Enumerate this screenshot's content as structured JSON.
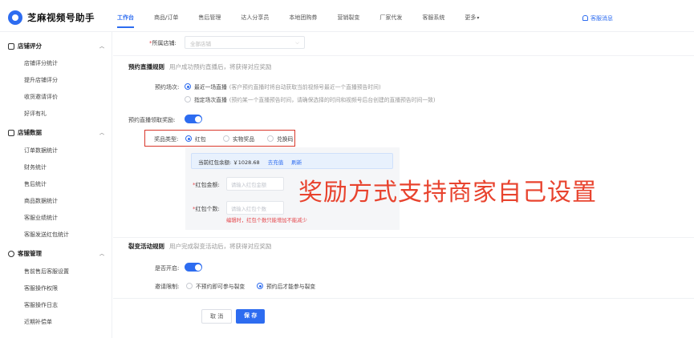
{
  "app": {
    "title": "芝麻视频号助手"
  },
  "nav": {
    "items": [
      "工作台",
      "商品/订单",
      "售后管理",
      "达人分享员",
      "本地团购券",
      "营销裂变",
      "厂家代发",
      "客服系统",
      "更多"
    ],
    "active_index": 0,
    "message": "客服消息"
  },
  "sidebar": {
    "groups": [
      {
        "title": "店铺评分",
        "icon": "shop-icon",
        "items": [
          "店铺评分统计",
          "提升店铺评分",
          "收货邀请评价",
          "好评有礼"
        ]
      },
      {
        "title": "店铺数据",
        "icon": "chart-icon",
        "items": [
          "订单数据统计",
          "财务统计",
          "售后统计",
          "商品数据统计",
          "客服业绩统计",
          "客服发送红包统计"
        ]
      },
      {
        "title": "客服管理",
        "icon": "headset-icon",
        "items": [
          "售前售后客服设置",
          "客服操作权限",
          "客服操作日志",
          "近期补偿单"
        ]
      }
    ]
  },
  "form": {
    "store": {
      "label": "所属店铺:",
      "placeholder": "全部店铺"
    },
    "live_section": {
      "title": "预约直播规则",
      "hint": "用户成功预约直播后，将获得对应奖励"
    },
    "live_session": {
      "label": "预约场次:",
      "options": [
        {
          "label": "最近一场直播",
          "note": "(客户预约直播时将自动获取当前视频号最近一个直播预告时间)",
          "selected": true
        },
        {
          "label": "指定场次直播",
          "note": "(预约某一个直播预告时间，请确保选择的时间和视频号后台创建的直播预告时间一致)",
          "selected": false
        }
      ]
    },
    "reward_toggle": {
      "label": "预约直播领取奖励:",
      "on": true
    },
    "reward_type": {
      "label": "奖品类型:",
      "options": [
        {
          "label": "红包",
          "selected": true
        },
        {
          "label": "实物奖品",
          "selected": false
        },
        {
          "label": "兑换码",
          "selected": false
        }
      ]
    },
    "balance": {
      "text": "当前红包余额: ￥1028.68",
      "recharge": "去充值",
      "refresh": "刷新"
    },
    "amount": {
      "label": "红包金额:",
      "placeholder": "请输入红包金额"
    },
    "count": {
      "label": "红包个数:",
      "placeholder": "请输入红包个数",
      "warning": "编辑时，红包个数只能增加不能减少"
    },
    "fission_section": {
      "title": "裂变活动规则",
      "hint": "用户完成裂变活动后，将获得对应奖励"
    },
    "fission_toggle": {
      "label": "是否开启:",
      "on": true
    },
    "invite_limit": {
      "label": "邀请限制:",
      "options": [
        {
          "label": "不预约即可参与裂变",
          "selected": false
        },
        {
          "label": "预约后才能参与裂变",
          "selected": true
        }
      ]
    }
  },
  "overlay": {
    "text": "奖励方式支持商家自己设置"
  },
  "footer": {
    "cancel": "取 消",
    "save": "保 存"
  },
  "colors": {
    "accent": "#2d6cf0",
    "highlight": "#d9372b",
    "overlay": "#e8432e",
    "warning": "#e5484d"
  }
}
